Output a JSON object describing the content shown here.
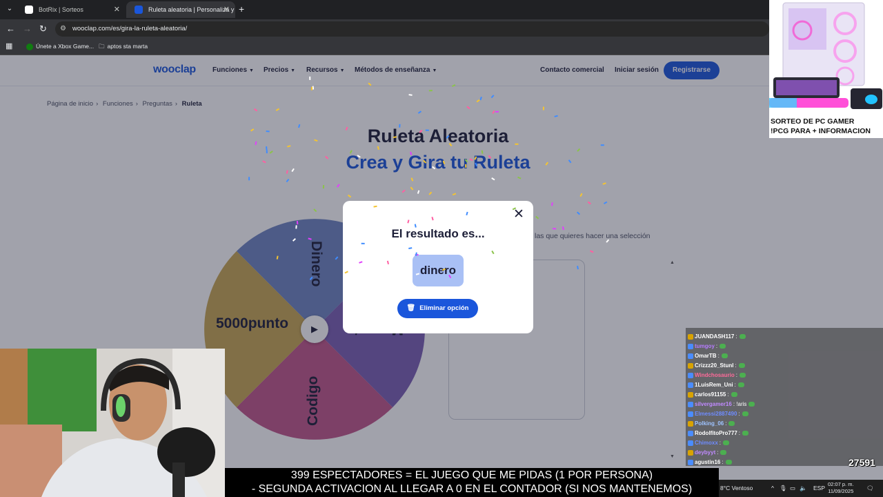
{
  "browser": {
    "tabs": [
      {
        "title": "BotRix | Sorteos",
        "active": false
      },
      {
        "title": "Ruleta aleatoria | Personaliza y g",
        "active": true
      }
    ],
    "url": "wooclap.com/es/gira-la-ruleta-aleatoria/",
    "bookmarks": [
      "Únete a Xbox Game...",
      "aptos sta marta"
    ]
  },
  "site": {
    "logo": "wooclap",
    "nav": [
      "Funciones",
      "Precios",
      "Recursos",
      "Métodos de enseñanza"
    ],
    "contact": "Contacto comercial",
    "login": "Iniciar sesión",
    "register": "Registrarse",
    "breadcrumb": [
      "Página de inicio",
      "Funciones",
      "Preguntas",
      "Ruleta"
    ],
    "title_line1": "Ruleta Aleatoria",
    "title_line2": "Crea y Gira tu Ruleta",
    "instruction": "las que quieres hacer una selección",
    "wheel": {
      "segments": [
        {
          "label": "Dinero",
          "color": "#6f86c2"
        },
        {
          "label": "Mascota",
          "color": "#7a5fb3"
        },
        {
          "label": "Codigo",
          "color": "#c2568a"
        },
        {
          "label": "5000punto",
          "color": "#c8a753"
        }
      ]
    }
  },
  "modal": {
    "title": "El resultado es...",
    "result": "dinero",
    "delete_label": "Eliminar opción"
  },
  "stream": {
    "ad_line1": "SORTEO DE PC GAMER",
    "ad_line2": "!PCG PARA + INFORMACION",
    "banner_line1": "399 ESPECTADORES = EL JUEGO QUE ME PIDAS (1 POR PERSONA)",
    "banner_line2": "- SEGUNDA ACTIVACION AL LLEGAR A 0 EN EL CONTADOR (SI NOS MANTENEMOS)",
    "counter": "27591",
    "chat": [
      {
        "user": "JUANDASH117",
        "text": ":",
        "color": "#ffffff"
      },
      {
        "user": "tumgoy",
        "text": ":",
        "color": "#b67cff"
      },
      {
        "user": "OmarTB",
        "text": ":",
        "color": "#ffffff"
      },
      {
        "user": "Crizzz20_Stunl",
        "text": ":",
        "color": "#ffffff"
      },
      {
        "user": "Windchosaurio",
        "text": ":",
        "color": "#ff6b9a"
      },
      {
        "user": "1LuisRem_Uni",
        "text": ":",
        "color": "#ffffff"
      },
      {
        "user": "carlos91155",
        "text": ":",
        "color": "#ffffff"
      },
      {
        "user": "silvergamer16",
        "text": ": !aris",
        "color": "#c08aff"
      },
      {
        "user": "Elmessi2887490",
        "text": ":",
        "color": "#6f8cff"
      },
      {
        "user": "Polking_06",
        "text": ":",
        "color": "#9ec3ff"
      },
      {
        "user": "RodolfitoPro777",
        "text": ":",
        "color": "#ffffff"
      },
      {
        "user": "Chimoxx",
        "text": ":",
        "color": "#6f8cff"
      },
      {
        "user": "deybyyt",
        "text": ":",
        "color": "#c08aff"
      },
      {
        "user": "agustin16",
        "text": ":",
        "color": "#ffffff"
      }
    ]
  },
  "taskbar": {
    "weather": "8°C  Ventoso",
    "lang": "ESP",
    "time": "02:07 p. m.",
    "date": "11/09/2025"
  }
}
